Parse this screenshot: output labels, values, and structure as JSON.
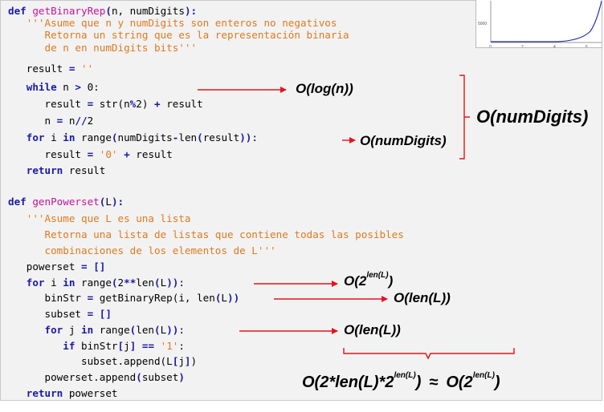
{
  "code": {
    "l1": [
      [
        "kw",
        "def "
      ],
      [
        "fn",
        "getBinaryRep"
      ],
      [
        "op",
        "("
      ],
      [
        "pl",
        "n, numDigits"
      ],
      [
        "op",
        "):"
      ]
    ],
    "l2": [
      [
        "pl",
        "   "
      ],
      [
        "str",
        "'''Asume que n y numDigits son enteros no negativos"
      ]
    ],
    "l3": [
      [
        "pl",
        "      "
      ],
      [
        "str",
        "Retorna un string que es la representación binaria"
      ]
    ],
    "l4": [
      [
        "pl",
        "      "
      ],
      [
        "str",
        "de n en numDigits bits'''"
      ]
    ],
    "l5": [
      [
        "pl",
        "   result "
      ],
      [
        "op",
        "="
      ],
      [
        "pl",
        " "
      ],
      [
        "str",
        "''"
      ]
    ],
    "l6": [
      [
        "pl",
        "   "
      ],
      [
        "kw",
        "while"
      ],
      [
        "pl",
        " n "
      ],
      [
        "op",
        ">"
      ],
      [
        "pl",
        " 0:"
      ]
    ],
    "l7": [
      [
        "pl",
        "      result "
      ],
      [
        "op",
        "="
      ],
      [
        "pl",
        " str(n"
      ],
      [
        "op",
        "%"
      ],
      [
        "pl",
        "2) "
      ],
      [
        "op",
        "+"
      ],
      [
        "pl",
        " result"
      ]
    ],
    "l8": [
      [
        "pl",
        "      n "
      ],
      [
        "op",
        "="
      ],
      [
        "pl",
        " n"
      ],
      [
        "op",
        "//"
      ],
      [
        "pl",
        "2"
      ]
    ],
    "l9": [
      [
        "pl",
        "   "
      ],
      [
        "kw",
        "for"
      ],
      [
        "pl",
        " i "
      ],
      [
        "kw",
        "in"
      ],
      [
        "pl",
        " range"
      ],
      [
        "op",
        "("
      ],
      [
        "pl",
        "numDigits"
      ],
      [
        "op",
        "-"
      ],
      [
        "pl",
        "len"
      ],
      [
        "op",
        "("
      ],
      [
        "pl",
        "result"
      ],
      [
        "op",
        "))"
      ],
      [
        "pl",
        ":"
      ]
    ],
    "l10": [
      [
        "pl",
        "      result "
      ],
      [
        "op",
        "="
      ],
      [
        "pl",
        " "
      ],
      [
        "str",
        "'0'"
      ],
      [
        "pl",
        " "
      ],
      [
        "op",
        "+"
      ],
      [
        "pl",
        " result"
      ]
    ],
    "l11": [
      [
        "pl",
        "   "
      ],
      [
        "kw",
        "return"
      ],
      [
        "pl",
        " result"
      ]
    ],
    "l12": [],
    "l13": [
      [
        "kw",
        "def "
      ],
      [
        "fn",
        "genPowerset"
      ],
      [
        "op",
        "("
      ],
      [
        "pl",
        "L"
      ],
      [
        "op",
        "):"
      ]
    ],
    "l14": [
      [
        "pl",
        "   "
      ],
      [
        "str",
        "'''Asume que L es una lista"
      ]
    ],
    "l15": [
      [
        "pl",
        "      "
      ],
      [
        "str",
        "Retorna una lista de listas que contiene todas las posibles"
      ]
    ],
    "l16": [
      [
        "pl",
        "      "
      ],
      [
        "str",
        "combinaciones de los elementos de L'''"
      ]
    ],
    "l17": [
      [
        "pl",
        "   powerset "
      ],
      [
        "op",
        "="
      ],
      [
        "pl",
        " "
      ],
      [
        "op",
        "[]"
      ]
    ],
    "l18": [
      [
        "pl",
        "   "
      ],
      [
        "kw",
        "for"
      ],
      [
        "pl",
        " i "
      ],
      [
        "kw",
        "in"
      ],
      [
        "pl",
        " range"
      ],
      [
        "op",
        "("
      ],
      [
        "pl",
        "2"
      ],
      [
        "op",
        "**"
      ],
      [
        "pl",
        "len"
      ],
      [
        "op",
        "("
      ],
      [
        "pl",
        "L"
      ],
      [
        "op",
        "))"
      ],
      [
        "pl",
        ":"
      ]
    ],
    "l19": [
      [
        "pl",
        "      binStr "
      ],
      [
        "op",
        "="
      ],
      [
        "pl",
        " getBinaryRep(i, len"
      ],
      [
        "op",
        "("
      ],
      [
        "pl",
        "L"
      ],
      [
        "op",
        "))"
      ]
    ],
    "l20": [
      [
        "pl",
        "      subset "
      ],
      [
        "op",
        "="
      ],
      [
        "pl",
        " "
      ],
      [
        "op",
        "[]"
      ]
    ],
    "l21": [
      [
        "pl",
        "      "
      ],
      [
        "kw",
        "for"
      ],
      [
        "pl",
        " j "
      ],
      [
        "kw",
        "in"
      ],
      [
        "pl",
        " range"
      ],
      [
        "op",
        "("
      ],
      [
        "pl",
        "len"
      ],
      [
        "op",
        "("
      ],
      [
        "pl",
        "L"
      ],
      [
        "op",
        "))"
      ],
      [
        "pl",
        ":"
      ]
    ],
    "l22": [
      [
        "pl",
        "         "
      ],
      [
        "kw",
        "if"
      ],
      [
        "pl",
        " binStr"
      ],
      [
        "op",
        "["
      ],
      [
        "pl",
        "j"
      ],
      [
        "op",
        "]"
      ],
      [
        "pl",
        " "
      ],
      [
        "op",
        "=="
      ],
      [
        "pl",
        " "
      ],
      [
        "str",
        "'1'"
      ],
      [
        "pl",
        ":"
      ]
    ],
    "l23": [
      [
        "pl",
        "            subset.append(L"
      ],
      [
        "op",
        "["
      ],
      [
        "pl",
        "j"
      ],
      [
        "op",
        "]"
      ],
      [
        "pl",
        ")"
      ]
    ],
    "l24": [
      [
        "pl",
        "      powerset.append"
      ],
      [
        "op",
        "("
      ],
      [
        "pl",
        "subset"
      ],
      [
        "op",
        ")"
      ]
    ],
    "l25": [
      [
        "pl",
        "   "
      ],
      [
        "kw",
        "return"
      ],
      [
        "pl",
        " powerset"
      ]
    ]
  },
  "annotations": {
    "log_n": "O(log(n))",
    "numdigits_big": "O(numDigits)",
    "numdigits_small": "O(numDigits)",
    "two_pow_base": "O(2",
    "two_pow_exp": "len(L)",
    "two_pow_close": ")",
    "len_l_1": "O(len(L))",
    "len_l_2": "O(len(L))",
    "total_a": "O(2*len(L)*2",
    "total_a_exp": "len(L)",
    "total_a_close": ")",
    "approx": "≈",
    "total_b": "O(2",
    "total_b_exp": "len(L)",
    "total_b_close": ")"
  },
  "thumbnail": {
    "tick_y": "5000",
    "tick_x": [
      "0",
      "2",
      "4",
      "6"
    ]
  },
  "colors": {
    "keyword": "#1a1aa6",
    "function_name": "#c8129a",
    "string": "#e07a1f",
    "arrow": "#e8121a"
  }
}
